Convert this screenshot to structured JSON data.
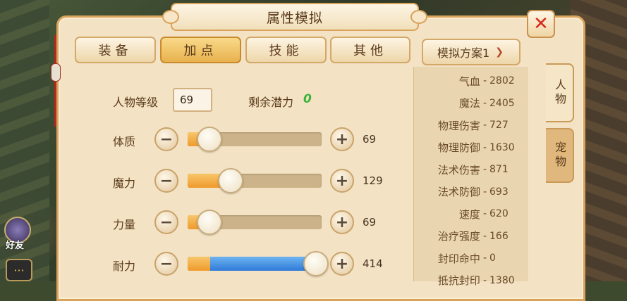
{
  "window": {
    "title": "属性模拟"
  },
  "tabs": [
    {
      "label": "装备",
      "active": false
    },
    {
      "label": "加点",
      "active": true
    },
    {
      "label": "技能",
      "active": false
    },
    {
      "label": "其他",
      "active": false
    }
  ],
  "plan_select": {
    "value": "模拟方案1"
  },
  "side_tabs": [
    {
      "label": "人物",
      "active": true
    },
    {
      "label": "宠物",
      "active": false
    }
  ],
  "level": {
    "label": "人物等级",
    "value": "69"
  },
  "potential": {
    "label": "剩余潜力",
    "value": "0"
  },
  "attributes": [
    {
      "label": "体质",
      "value": "69",
      "fill": 0.1
    },
    {
      "label": "魔力",
      "value": "129",
      "fill": 0.26
    },
    {
      "label": "力量",
      "value": "69",
      "fill": 0.1
    },
    {
      "label": "耐力",
      "value": "414",
      "fill": 1.0
    }
  ],
  "stats": [
    {
      "label": "气血",
      "value": "2802"
    },
    {
      "label": "魔法",
      "value": "2405"
    },
    {
      "label": "物理伤害",
      "value": "727"
    },
    {
      "label": "物理防御",
      "value": "1630"
    },
    {
      "label": "法术伤害",
      "value": "871"
    },
    {
      "label": "法术防御",
      "value": "693"
    },
    {
      "label": "速度",
      "value": "620"
    },
    {
      "label": "治疗强度",
      "value": "166"
    },
    {
      "label": "封印命中",
      "value": "0"
    },
    {
      "label": "抵抗封印",
      "value": "1380"
    }
  ],
  "hud": {
    "friends_label": "好友"
  },
  "icons": {
    "close": "close-icon",
    "minus": "minus-icon",
    "plus": "plus-icon",
    "chevron": "chevron-down-icon",
    "chat": "chat-icon"
  },
  "colors": {
    "accent": "#e8b24e",
    "potential": "#3bb43b",
    "close": "#d62a1e"
  }
}
